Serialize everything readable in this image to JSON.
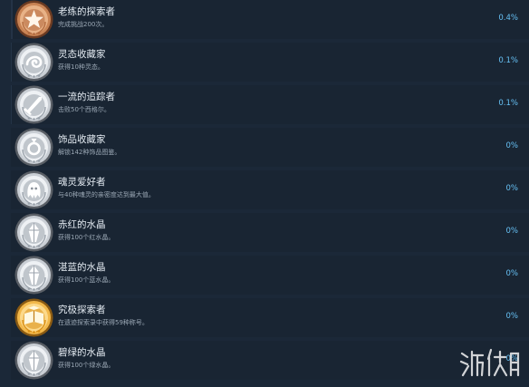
{
  "colors": {
    "row_bg": "#192533",
    "bar_bg": "#243346",
    "title": "#e5ecf3",
    "desc": "#9aa7b4",
    "percent": "#66c0f4"
  },
  "achievements": [
    {
      "title": "老练的探索者",
      "desc": "完成挑战200次。",
      "percent": "0.4%",
      "percent_value": 0.4,
      "badge": "bronze",
      "icon": "star-icon"
    },
    {
      "title": "灵态收藏家",
      "desc": "获得10种灵态。",
      "percent": "0.1%",
      "percent_value": 0.1,
      "badge": "silver",
      "icon": "swirl-icon"
    },
    {
      "title": "一流的追踪者",
      "desc": "击败50个西格尔。",
      "percent": "0.1%",
      "percent_value": 0.1,
      "badge": "silver",
      "icon": "sword-icon"
    },
    {
      "title": "饰品收藏家",
      "desc": "解锁142种饰品图鉴。",
      "percent": "0%",
      "percent_value": 0,
      "badge": "silver",
      "icon": "ring-icon"
    },
    {
      "title": "魂灵爱好者",
      "desc": "与40种魂灵的亲密度达到最大值。",
      "percent": "0%",
      "percent_value": 0,
      "badge": "silver",
      "icon": "spirit-icon"
    },
    {
      "title": "赤红的水晶",
      "desc": "获得100个红水晶。",
      "percent": "0%",
      "percent_value": 0,
      "badge": "silver",
      "icon": "crystal-icon"
    },
    {
      "title": "湛蓝的水晶",
      "desc": "获得100个蓝水晶。",
      "percent": "0%",
      "percent_value": 0,
      "badge": "silver",
      "icon": "crystal-icon"
    },
    {
      "title": "究极探索者",
      "desc": "在遗迹探索录中获得59种称号。",
      "percent": "0%",
      "percent_value": 0,
      "badge": "gold",
      "icon": "book-icon"
    },
    {
      "title": "碧绿的水晶",
      "desc": "获得100个绿水晶。",
      "percent": "0%",
      "percent_value": 0,
      "badge": "silver",
      "icon": "crystal-icon"
    }
  ],
  "watermark": {
    "text": "游侠网"
  }
}
